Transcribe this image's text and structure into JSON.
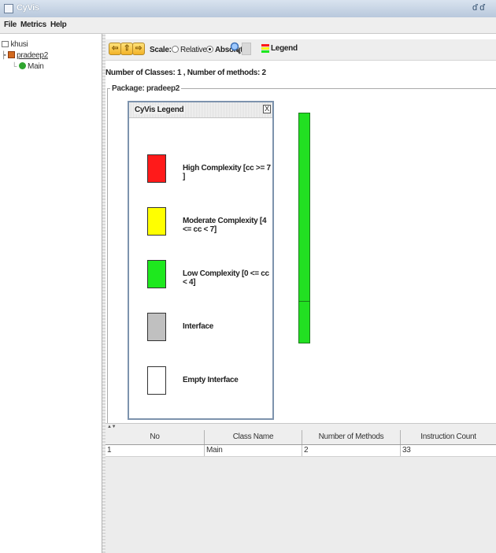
{
  "window": {
    "title": "CyVis",
    "controls": "ď ď"
  },
  "menu": [
    "File",
    "Metrics",
    "Help"
  ],
  "tree": {
    "root": "khusi",
    "package": "pradeep2",
    "class": "Main"
  },
  "toolbar": {
    "scale_label": "Scale:",
    "relative_label": "Relative",
    "absolute_label": "Absolute",
    "selected": "Absolute",
    "legend_label": "Legend"
  },
  "summary": "Number of Classes: 1 , Number of methods: 2",
  "package_label": "Package: pradeep2",
  "legend": {
    "title": "CyVis Legend",
    "close": "X",
    "items": [
      {
        "color": "#ff1a1a",
        "label": "High Complexity [cc >= 7 ]"
      },
      {
        "color": "#ffff00",
        "label": "Moderate Complexity [4 <= cc < 7]"
      },
      {
        "color": "#1ee81e",
        "label": "Low Complexity [0 <= cc < 4]"
      },
      {
        "color": "#c0c0c0",
        "label": "Interface"
      },
      {
        "color": "#ffffff",
        "label": "Empty Interface"
      }
    ]
  },
  "table": {
    "columns": [
      "No",
      "Class Name",
      "Number of Methods",
      "Instruction Count"
    ],
    "rows": [
      [
        "1",
        "Main",
        "2",
        "33"
      ]
    ]
  }
}
